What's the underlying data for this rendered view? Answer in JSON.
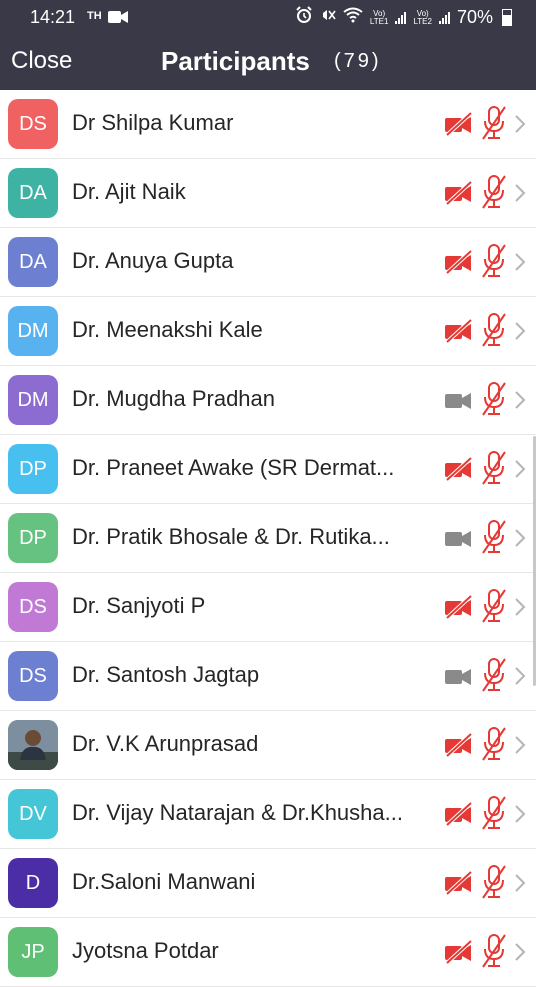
{
  "status_bar": {
    "time": "14:21",
    "carrier": "TH",
    "sim1": [
      "Vo)",
      "LTE1"
    ],
    "sim2": [
      "Vo)",
      "LTE2"
    ],
    "battery": "70%"
  },
  "header": {
    "close_label": "Close",
    "title": "Participants",
    "count": "(79)"
  },
  "colors": {
    "header_bg": "#3a3947",
    "muted_red": "#e53935",
    "camera_on_gray": "#8a8a8a"
  },
  "participants": [
    {
      "initials": "DS",
      "name": "Dr Shilpa Kumar",
      "color": "#f06262",
      "video": "off"
    },
    {
      "initials": "DA",
      "name": "Dr. Ajit Naik",
      "color": "#3fb3a3",
      "video": "off"
    },
    {
      "initials": "DA",
      "name": "Dr. Anuya Gupta",
      "color": "#6c7fd0",
      "video": "off"
    },
    {
      "initials": "DM",
      "name": "Dr. Meenakshi Kale",
      "color": "#58b2f0",
      "video": "off"
    },
    {
      "initials": "DM",
      "name": "Dr. Mugdha Pradhan",
      "color": "#8c6cd0",
      "video": "on"
    },
    {
      "initials": "DP",
      "name": "Dr. Praneet Awake (SR Dermat...",
      "color": "#48c0ef",
      "video": "off"
    },
    {
      "initials": "DP",
      "name": "Dr. Pratik Bhosale & Dr. Rutika...",
      "color": "#66c281",
      "video": "on"
    },
    {
      "initials": "DS",
      "name": "Dr. Sanjyoti P",
      "color": "#c07ad6",
      "video": "off"
    },
    {
      "initials": "DS",
      "name": "Dr. Santosh Jagtap",
      "color": "#6c7fd0",
      "video": "on"
    },
    {
      "initials": "",
      "name": "Dr. V.K Arunprasad",
      "color": "#5a7a9a",
      "video": "off",
      "photo": true
    },
    {
      "initials": "DV",
      "name": "Dr. Vijay Natarajan & Dr.Khusha...",
      "color": "#45c6d6",
      "video": "off"
    },
    {
      "initials": "D",
      "name": "Dr.Saloni Manwani",
      "color": "#4b2ea6",
      "video": "off"
    },
    {
      "initials": "JP",
      "name": "Jyotsna Potdar",
      "color": "#5fbf74",
      "video": "off"
    }
  ]
}
